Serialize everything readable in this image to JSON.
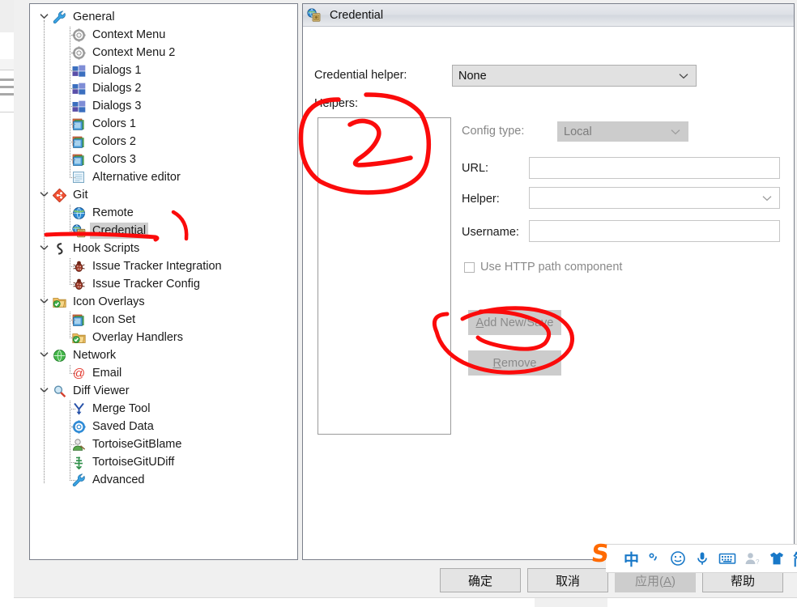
{
  "window": {
    "title": "Credential",
    "title_icon": "globe-vault-icon"
  },
  "sidebar": {
    "items": [
      {
        "label": "General",
        "icon": "wrench-icon",
        "depth": 0,
        "expander": "expanded"
      },
      {
        "label": "Context Menu",
        "icon": "gear-icon",
        "depth": 1,
        "expander": ""
      },
      {
        "label": "Context Menu 2",
        "icon": "gear-icon",
        "depth": 1,
        "expander": ""
      },
      {
        "label": "Dialogs 1",
        "icon": "windows-icon",
        "depth": 1,
        "expander": ""
      },
      {
        "label": "Dialogs 2",
        "icon": "windows-icon",
        "depth": 1,
        "expander": ""
      },
      {
        "label": "Dialogs 3",
        "icon": "windows-icon",
        "depth": 1,
        "expander": ""
      },
      {
        "label": "Colors 1",
        "icon": "palette-icon",
        "depth": 1,
        "expander": ""
      },
      {
        "label": "Colors 2",
        "icon": "palette-icon",
        "depth": 1,
        "expander": ""
      },
      {
        "label": "Colors 3",
        "icon": "palette-icon",
        "depth": 1,
        "expander": ""
      },
      {
        "label": "Alternative editor",
        "icon": "notepad-icon",
        "depth": 1,
        "expander": ""
      },
      {
        "label": "Git",
        "icon": "git-icon",
        "depth": 0,
        "expander": "expanded"
      },
      {
        "label": "Remote",
        "icon": "globe-icon",
        "depth": 1,
        "expander": ""
      },
      {
        "label": "Credential",
        "icon": "globe-vault-icon",
        "depth": 1,
        "expander": "",
        "selected": true
      },
      {
        "label": "Hook Scripts",
        "icon": "hook-icon",
        "depth": 0,
        "expander": "expanded"
      },
      {
        "label": "Issue Tracker Integration",
        "icon": "bug-icon",
        "depth": 1,
        "expander": ""
      },
      {
        "label": "Issue Tracker Config",
        "icon": "bug-icon",
        "depth": 1,
        "expander": ""
      },
      {
        "label": "Icon Overlays",
        "icon": "folder-check-icon",
        "depth": 0,
        "expander": "expanded"
      },
      {
        "label": "Icon Set",
        "icon": "palette-icon",
        "depth": 1,
        "expander": ""
      },
      {
        "label": "Overlay Handlers",
        "icon": "folder-check-icon",
        "depth": 1,
        "expander": ""
      },
      {
        "label": "Network",
        "icon": "globe-green-icon",
        "depth": 0,
        "expander": "expanded"
      },
      {
        "label": "Email",
        "icon": "at-sign-icon",
        "depth": 1,
        "expander": ""
      },
      {
        "label": "Diff Viewer",
        "icon": "magnifier-icon",
        "depth": 0,
        "expander": "expanded"
      },
      {
        "label": "Merge Tool",
        "icon": "merge-icon",
        "depth": 1,
        "expander": ""
      },
      {
        "label": "Saved Data",
        "icon": "gear-blue-icon",
        "depth": 1,
        "expander": ""
      },
      {
        "label": "TortoiseGitBlame",
        "icon": "person-icon",
        "depth": 1,
        "expander": ""
      },
      {
        "label": "TortoiseGitUDiff",
        "icon": "udiff-icon",
        "depth": 1,
        "expander": ""
      },
      {
        "label": "Advanced",
        "icon": "wrench-icon",
        "depth": 1,
        "expander": ""
      }
    ]
  },
  "main": {
    "credential_helper_label": "Credential helper:",
    "credential_helper_value": "None",
    "helpers_label": "Helpers:",
    "config_type_label": "Config type:",
    "config_type_value": "Local",
    "url_label": "URL:",
    "url_value": "",
    "helper_label": "Helper:",
    "helper_value": "",
    "username_label": "Username:",
    "username_value": "",
    "use_http_path_label": "Use HTTP path component",
    "add_new_save_accel": "A",
    "add_new_save_rest": "dd New/Save",
    "remove_accel": "R",
    "remove_rest": "emove"
  },
  "footer": {
    "ok_label": "确定",
    "cancel_label": "取消",
    "apply_prefix": "应用(",
    "apply_accel": "A",
    "apply_suffix": ")",
    "help_label": "帮助"
  },
  "ime": {
    "logo": "S",
    "items": [
      {
        "glyph": "中",
        "name": "chinese-mode-icon"
      },
      {
        "glyph": "°,",
        "name": "punctuation-mode-icon"
      },
      {
        "glyph": "☺",
        "name": "emoji-icon"
      },
      {
        "glyph": "⬤",
        "name": "microphone-icon"
      },
      {
        "glyph": "⌨",
        "name": "soft-keyboard-icon"
      },
      {
        "glyph": "♟",
        "name": "user-account-icon"
      },
      {
        "glyph": "♟",
        "name": "skin-shirt-icon"
      },
      {
        "glyph": "简",
        "name": "simplified-chinese-icon"
      }
    ]
  },
  "annotations": {
    "marker_color": "#fb0b0b",
    "marks": [
      {
        "name": "underline-credential-tree-item"
      },
      {
        "name": "hook-stroke-right-of-credential"
      },
      {
        "name": "circled-number-2-over-helpers-list"
      },
      {
        "name": "circle-around-remove-button"
      }
    ]
  }
}
